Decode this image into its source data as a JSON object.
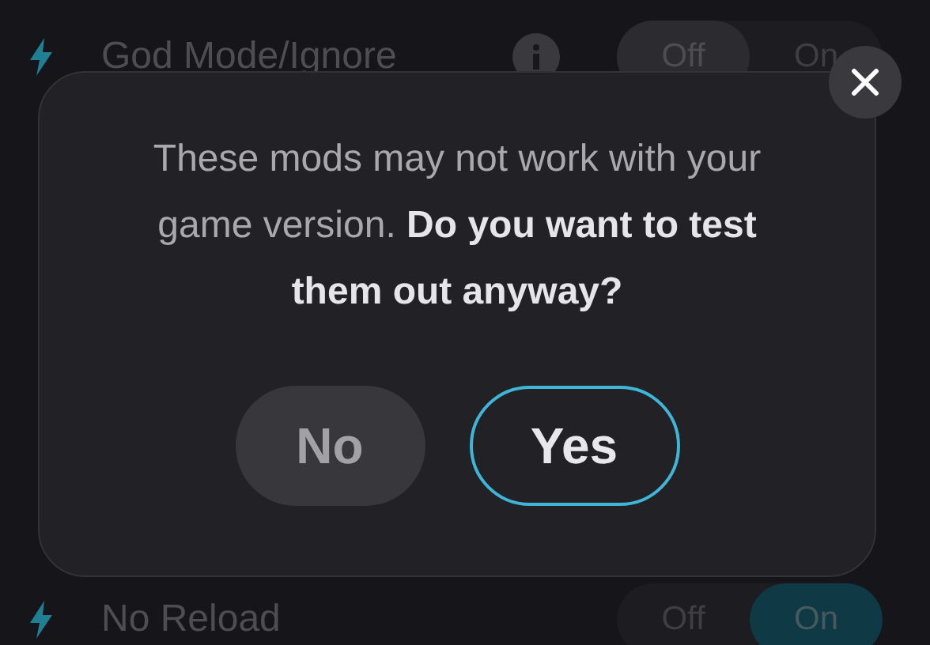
{
  "mods": [
    {
      "name": "God Mode/Ignore",
      "info": true,
      "options": [
        {
          "label": "Off",
          "selected": true
        },
        {
          "label": "On",
          "selected": false
        }
      ]
    },
    {
      "name": "No Reload",
      "info": false,
      "options": [
        {
          "label": "Off",
          "selected": false
        },
        {
          "label": "On",
          "selected": true
        }
      ]
    }
  ],
  "dialog": {
    "message": "These mods may not work with your game version. **Do you want to test them out anyway?**",
    "buttons": [
      {
        "label": "No",
        "kind": "secondary"
      },
      {
        "label": "Yes",
        "kind": "primary"
      }
    ]
  }
}
